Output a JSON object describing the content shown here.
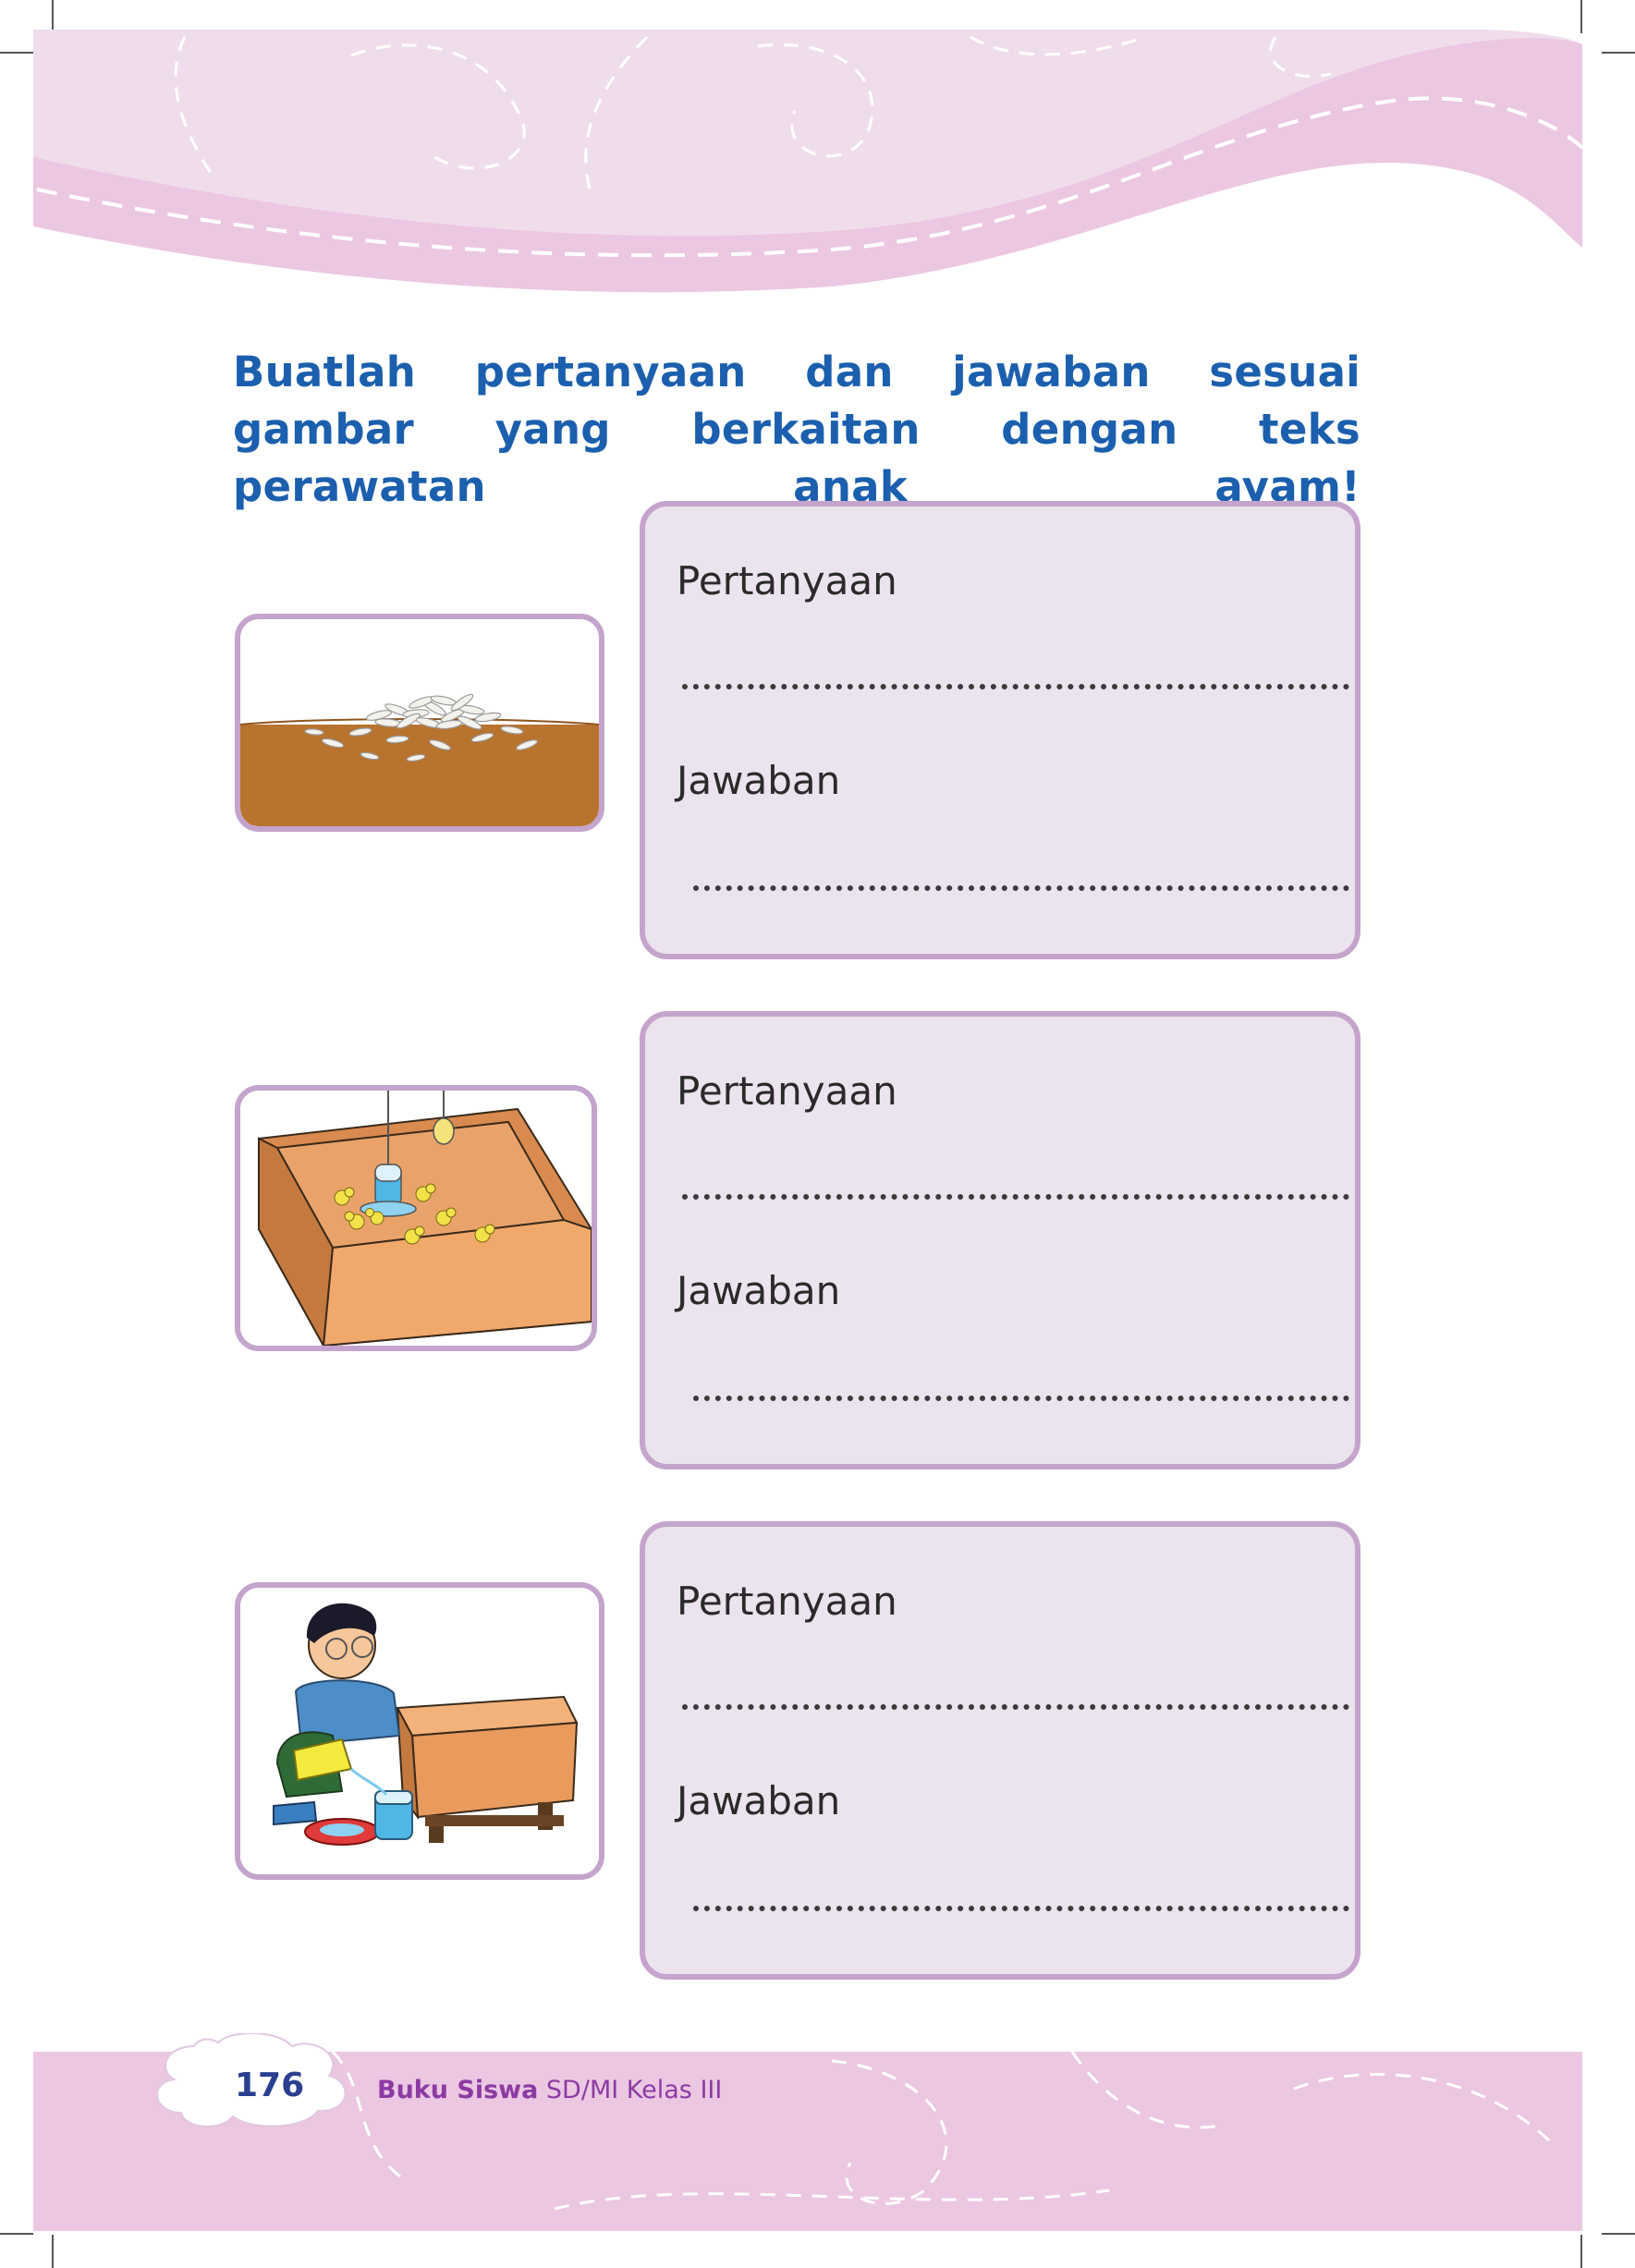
{
  "instruction": "Buatlah pertanyaan dan jawaban sesuai gambar yang berkaitan dengan teks perawatan anak ayam!",
  "exercises": [
    {
      "question_label": "Pertanyaan",
      "question_dots": "...........................................................",
      "answer_label": "Jawaban",
      "answer_dots": "........................................................"
    },
    {
      "question_label": "Pertanyaan",
      "question_dots": "...........................................................",
      "answer_label": "Jawaban",
      "answer_dots": "........................................................"
    },
    {
      "question_label": "Pertanyaan",
      "question_dots": "...........................................................",
      "answer_label": "Jawaban",
      "answer_dots": "........................................................"
    }
  ],
  "images": [
    {
      "icon": "rice-grains-on-soil-icon"
    },
    {
      "icon": "chick-brooder-box-icon"
    },
    {
      "icon": "boy-filling-water-icon"
    }
  ],
  "footer": {
    "page_number": "176",
    "book_title": "Buku Siswa",
    "book_level": "SD/MI Kelas III"
  },
  "colors": {
    "header_pink": "#ecc7e2",
    "frame_purple": "#c4a4cc",
    "box_fill": "#ebe3ee",
    "instruction_blue": "#1b5fae",
    "footer_purple": "#8c3ba3"
  }
}
